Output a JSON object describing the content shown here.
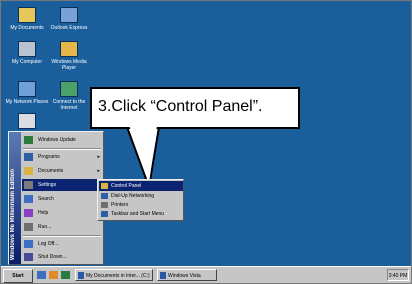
{
  "desktop": {
    "icons": [
      {
        "name": "my-documents-icon",
        "label": "My Documents",
        "color": "#e6c75a"
      },
      {
        "name": "outlook-express-icon",
        "label": "Outlook Express",
        "color": "#7aa0d8"
      },
      {
        "name": "my-computer-icon",
        "label": "My Computer",
        "color": "#b9c3d0"
      },
      {
        "name": "windows-media-player-icon",
        "label": "Windows Media Player",
        "color": "#e5b64a"
      },
      {
        "name": "network-places-icon",
        "label": "My Network Places",
        "color": "#6fa0d6"
      },
      {
        "name": "connect-internet-icon",
        "label": "Connect to the Internet",
        "color": "#4aa16a"
      },
      {
        "name": "recycle-bin-icon",
        "label": "",
        "color": "#d9dde3"
      }
    ]
  },
  "callout": {
    "text": "3.Click “Control Panel”."
  },
  "start_menu": {
    "band_label": "Windows Me Millennium Edition",
    "items": [
      {
        "name": "sm-item-windows-update",
        "label": "Windows Update",
        "arrow": "",
        "color": "#2a7c3e"
      },
      {
        "name": "sm-item-programs",
        "label": "Programs",
        "arrow": "▸",
        "color": "#2c5fa8"
      },
      {
        "name": "sm-item-documents",
        "label": "Documents",
        "arrow": "▸",
        "color": "#d8b340"
      },
      {
        "name": "sm-item-settings",
        "label": "Settings",
        "arrow": "▸",
        "color": "#7b7b7b"
      },
      {
        "name": "sm-item-search",
        "label": "Search",
        "arrow": "▸",
        "color": "#3d6ec2"
      },
      {
        "name": "sm-item-help",
        "label": "Help",
        "arrow": "",
        "color": "#8a3ec2"
      },
      {
        "name": "sm-item-run",
        "label": "Run...",
        "arrow": "",
        "color": "#6f6f6f"
      },
      {
        "name": "sm-item-log-off",
        "label": "Log Off...",
        "arrow": "",
        "color": "#3b6fc4"
      },
      {
        "name": "sm-item-shut-down",
        "label": "Shut Down...",
        "arrow": "",
        "color": "#4a4a9a"
      }
    ]
  },
  "settings_submenu": {
    "items": [
      {
        "name": "sub-control-panel",
        "label": "Control Panel",
        "color": "#d8b340"
      },
      {
        "name": "sub-dialup",
        "label": "Dial-Up Networking",
        "color": "#2c5fa8"
      },
      {
        "name": "sub-printers",
        "label": "Printers",
        "color": "#6f6f6f"
      },
      {
        "name": "sub-taskbar",
        "label": "Taskbar and Start Menu",
        "color": "#2c5fa8"
      }
    ]
  },
  "taskbar": {
    "start_label": "Start",
    "tasks": [
      "My Documents in Inter... (C:)",
      "Windows Vista"
    ],
    "tray_text": "3:40 PM"
  }
}
